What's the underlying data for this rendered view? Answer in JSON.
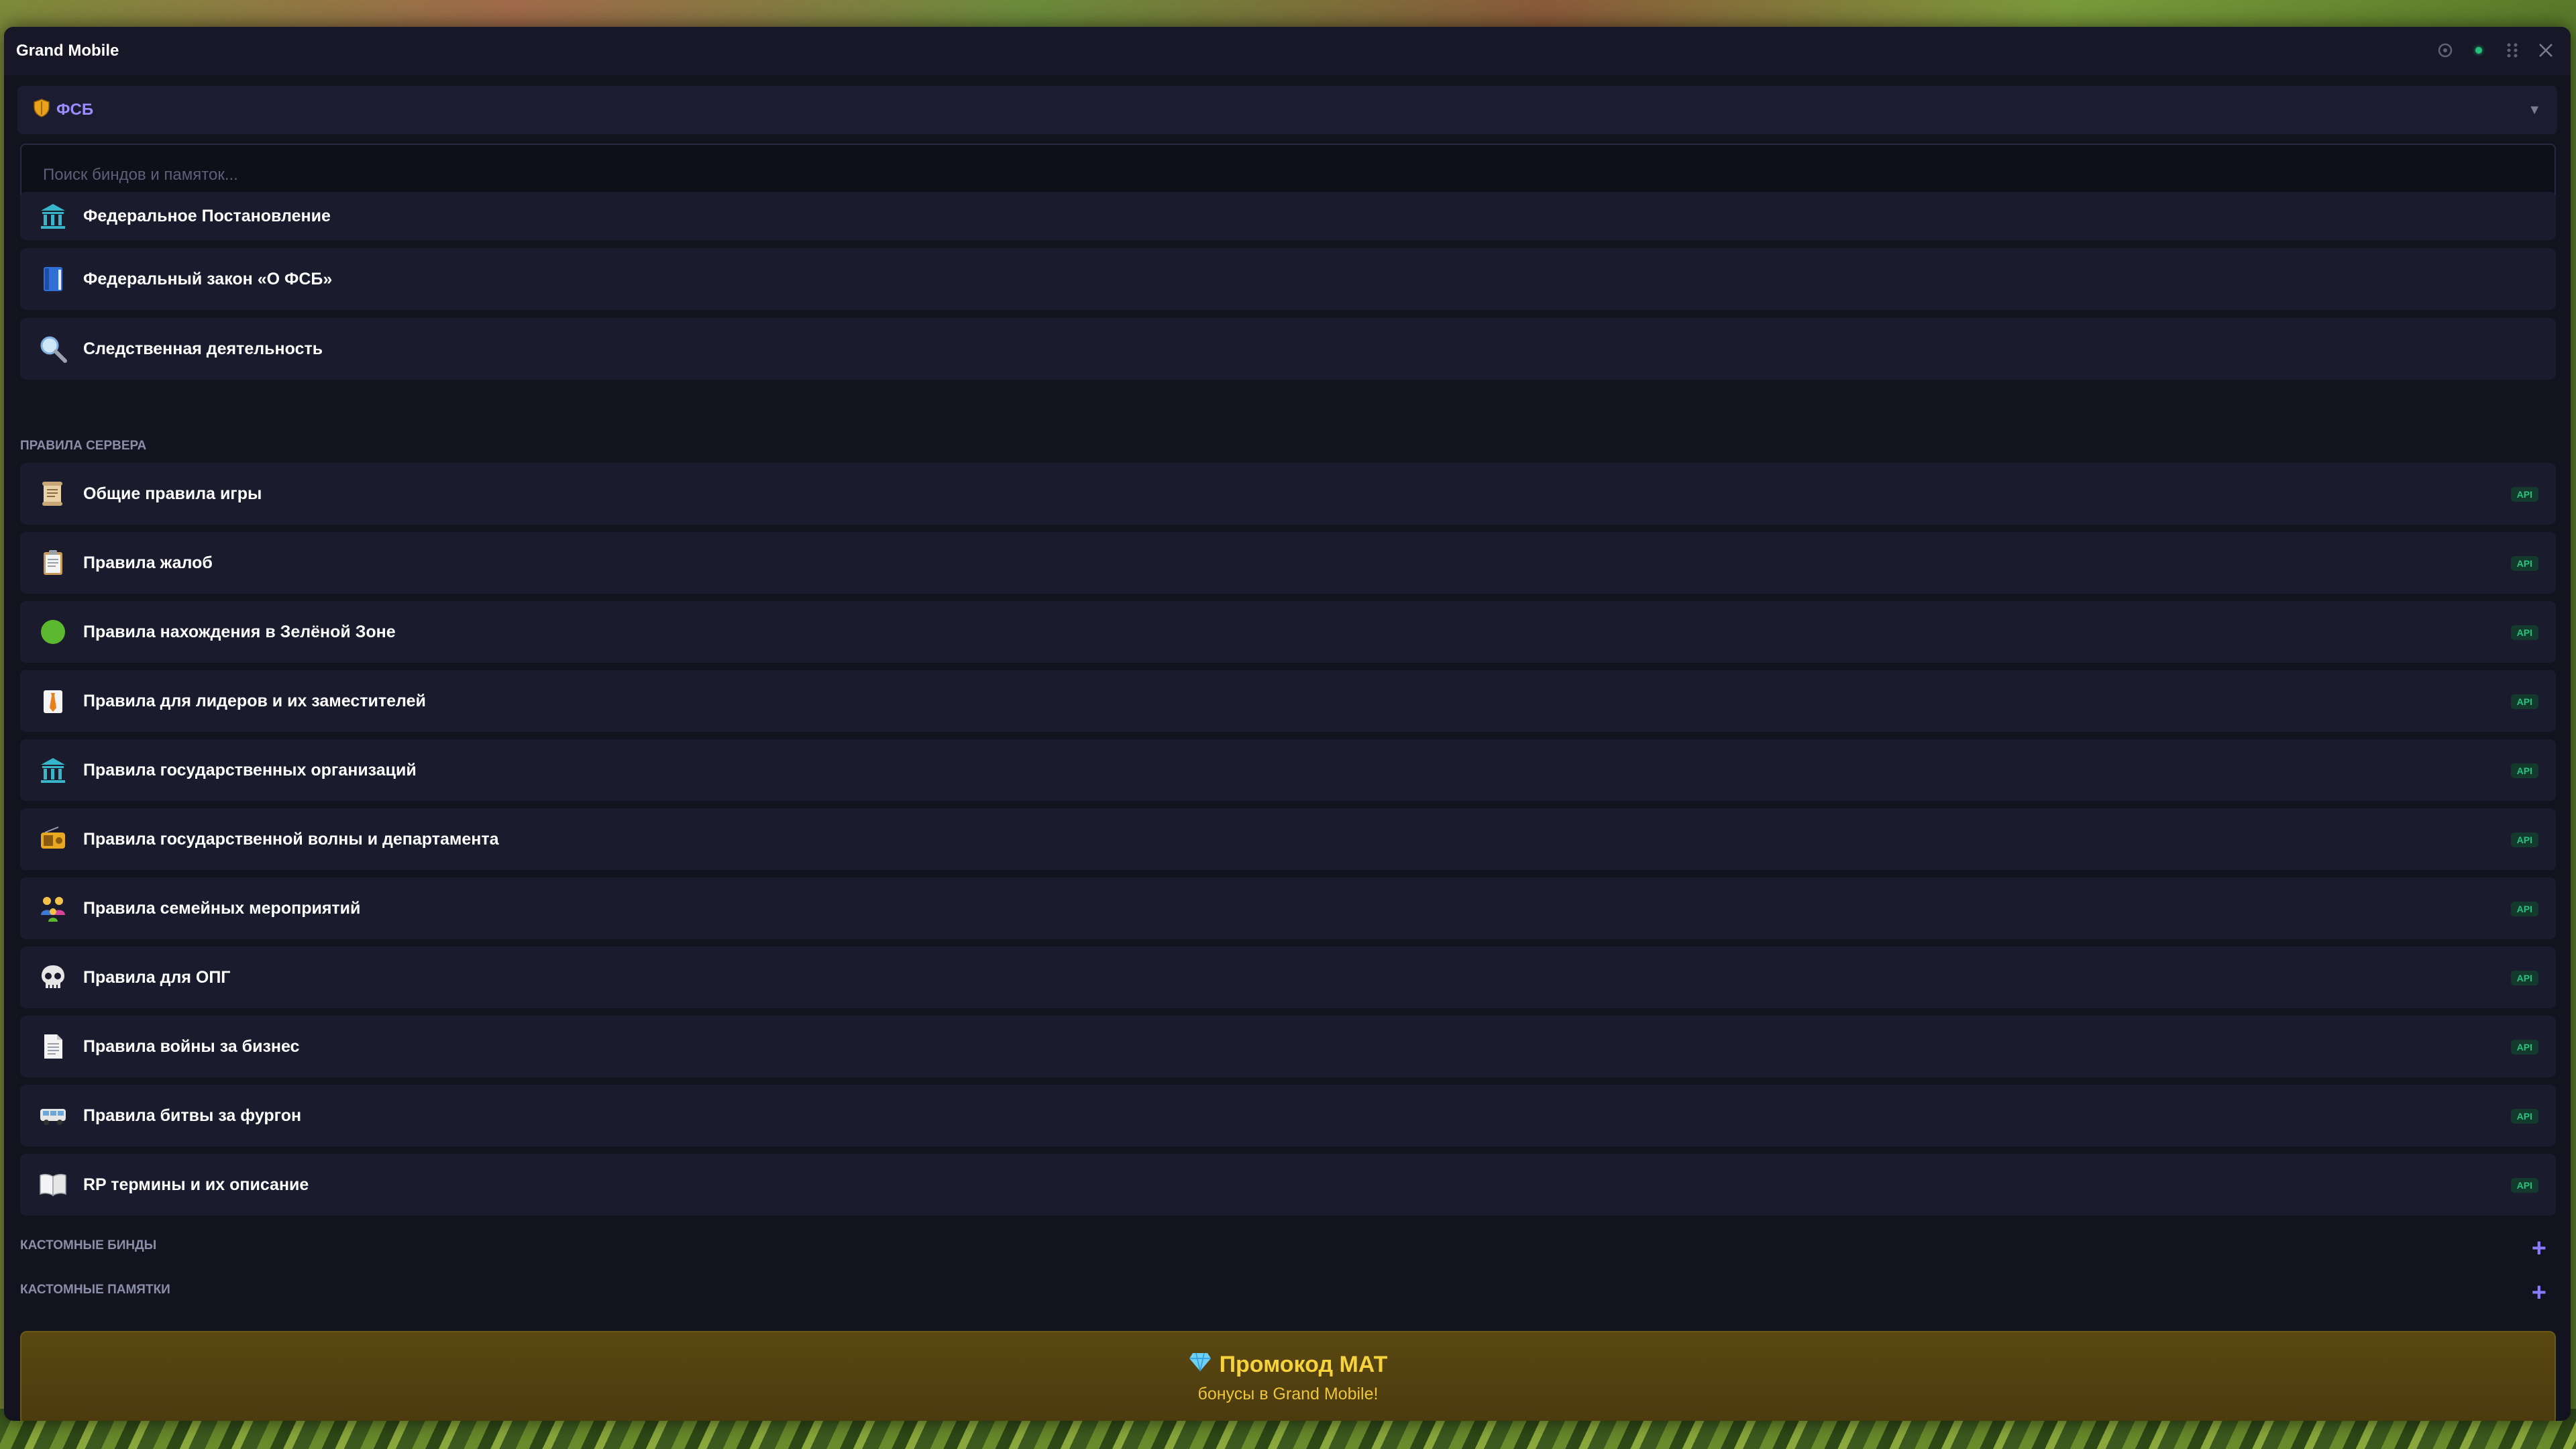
{
  "window": {
    "title": "Grand Mobile"
  },
  "faction": {
    "label": "ФСБ",
    "icon": "shield-icon"
  },
  "search": {
    "placeholder": "Поиск биндов и памяток..."
  },
  "top_items": [
    {
      "label": "Федеральное Постановление",
      "icon": "government-building-icon"
    },
    {
      "label": "Федеральный закон «О ФСБ»",
      "icon": "blue-book-icon"
    },
    {
      "label": "Следственная деятельность",
      "icon": "magnifier-icon"
    }
  ],
  "server_rules": {
    "title": "ПРАВИЛА СЕРВЕРА",
    "badge": "API",
    "items": [
      {
        "label": "Общие правила игры",
        "icon": "scroll-icon"
      },
      {
        "label": "Правила жалоб",
        "icon": "clipboard-icon"
      },
      {
        "label": "Правила нахождения в Зелёной Зоне",
        "icon": "green-circle-icon"
      },
      {
        "label": "Правила для лидеров и их заместителей",
        "icon": "leader-tie-icon"
      },
      {
        "label": "Правила государственных организаций",
        "icon": "government-building-icon"
      },
      {
        "label": "Правила государственной волны и департамента",
        "icon": "radio-icon"
      },
      {
        "label": "Правила семейных мероприятий",
        "icon": "family-icon"
      },
      {
        "label": "Правила для ОПГ",
        "icon": "skull-icon"
      },
      {
        "label": "Правила войны за бизнес",
        "icon": "document-icon"
      },
      {
        "label": "Правила битвы за фургон",
        "icon": "van-icon"
      },
      {
        "label": "RP термины и их описание",
        "icon": "open-book-icon"
      }
    ]
  },
  "custom_binds": {
    "title": "КАСТОМНЫЕ БИНДЫ",
    "add": "+"
  },
  "custom_notes": {
    "title": "КАСТОМНЫЕ ПАМЯТКИ",
    "add": "+"
  },
  "promo": {
    "title": "Промокод МАТ",
    "subtitle": "бонусы в Grand Mobile!",
    "icon": "diamond-icon"
  }
}
